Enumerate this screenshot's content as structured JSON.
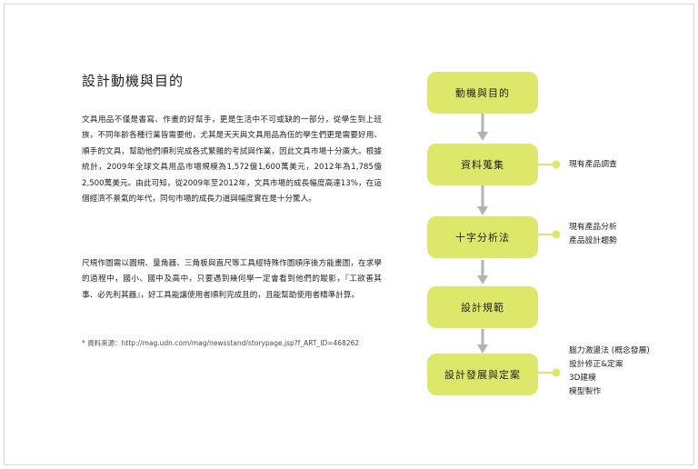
{
  "title": "設計動機與目的",
  "paragraphs": [
    "文具用品不僅是書寫、作畫的好幫手，更是生活中不可或缺的一部分，從學生到上班族，不同年齡各種行業皆需要他，尤其是天天與文具用品為伍的學生們更是需要好用、順手的文具，幫助他們順利完成各式繁雜的考試與作業，因此文具市場十分廣大。根據統計，2009年全球文具用品市場規模為1,572億1,600萬美元，2012年為1,785億2,500萬美元。由此可知，從2009年至2012年，文具市場的成長幅度高達13%，在這個經濟不景氣的年代，同句市場的成長力道與幅度實在是十分驚人。",
    "尺規作圖需以圓規、量角器、三角板與直尺等工具經特殊作圖順序後方能畫圖，在求學的過程中，國小、國中及高中，只要遇到幾何學一定會看到他們的蹤影，『工欲善其事、必先利其器』，好工具能讓使用者順利完成且的，且能幫助使用者精準計算。"
  ],
  "source": "* 資料來源：http://mag.udn.com/mag/newsstand/storypage.jsp?f_ART_ID=468262",
  "flow": {
    "steps": [
      "動機與目的",
      "資料蒐集",
      "十字分析法",
      "設計規範",
      "設計發展與定案"
    ],
    "notes": {
      "collect": [
        "現有產品調查"
      ],
      "cross": [
        "現有產品分析",
        "產品設計趨勢"
      ],
      "develop": [
        "腦力激盪法 (概念發展)",
        "設計修正&定案",
        "3D建模",
        "模型製作"
      ]
    },
    "colors": {
      "box": "#dde76a",
      "arrow": "#b3b3b3",
      "connector": "#dde76a"
    }
  }
}
